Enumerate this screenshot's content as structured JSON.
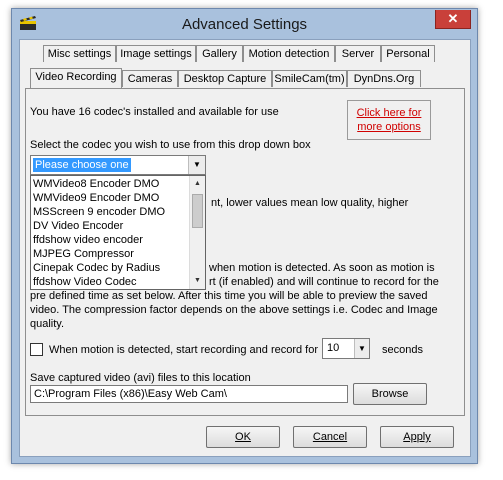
{
  "window": {
    "title": "Advanced Settings",
    "close_glyph": "✕"
  },
  "tabs": {
    "row_back": [
      {
        "name": "tab-misc-settings",
        "label": "Misc settings"
      },
      {
        "name": "tab-image-settings",
        "label": "Image settings"
      },
      {
        "name": "tab-gallery",
        "label": "Gallery"
      },
      {
        "name": "tab-motion-detection",
        "label": "Motion detection"
      },
      {
        "name": "tab-server",
        "label": "Server"
      },
      {
        "name": "tab-personal",
        "label": "Personal"
      }
    ],
    "row_front": [
      {
        "name": "tab-video-recording",
        "label": "Video Recording",
        "active": true
      },
      {
        "name": "tab-cameras",
        "label": "Cameras"
      },
      {
        "name": "tab-desktop-capture",
        "label": "Desktop Capture"
      },
      {
        "name": "tab-smilecam",
        "label": "SmileCam(tm)"
      },
      {
        "name": "tab-dyndns",
        "label": "DynDns.Org"
      }
    ]
  },
  "panel": {
    "codec_count_text": "You have 16 codec's installed and available for use",
    "link_line1": "Click here for",
    "link_line2": "more options",
    "select_codec_label": "Select the codec you wish to use from this drop down box",
    "codec_selected": "Please choose one",
    "codec_options": [
      "WMVideo8 Encoder DMO",
      "WMVideo9 Encoder DMO",
      "MSScreen 9 encoder DMO",
      "DV Video Encoder",
      "ffdshow video encoder",
      "MJPEG Compressor",
      "Cinepak Codec by Radius",
      "ffdshow Video Codec"
    ],
    "quality_partial": "nt, lower values mean low quality, higher",
    "motion_line1_partial": "when motion is detected. As soon as motion is",
    "motion_line2_partial": "rt (if enabled) and will continue to record for the",
    "motion_line3": "pre defined time as set below. After this time you will be able to preview the saved",
    "motion_line4": "video. The compression factor depends on the above settings i.e. Codec and Image",
    "motion_line5": "quality.",
    "checkbox_label": "When motion is detected, start recording and record for",
    "seconds_value": "10",
    "seconds_label": "seconds",
    "save_label": "Save captured video (avi) files to this location",
    "save_path": "C:\\Program Files (x86)\\Easy Web Cam\\",
    "browse_label": "Browse"
  },
  "footer": {
    "ok_label": "OK",
    "cancel_label": "Cancel",
    "apply_label": "Apply"
  }
}
